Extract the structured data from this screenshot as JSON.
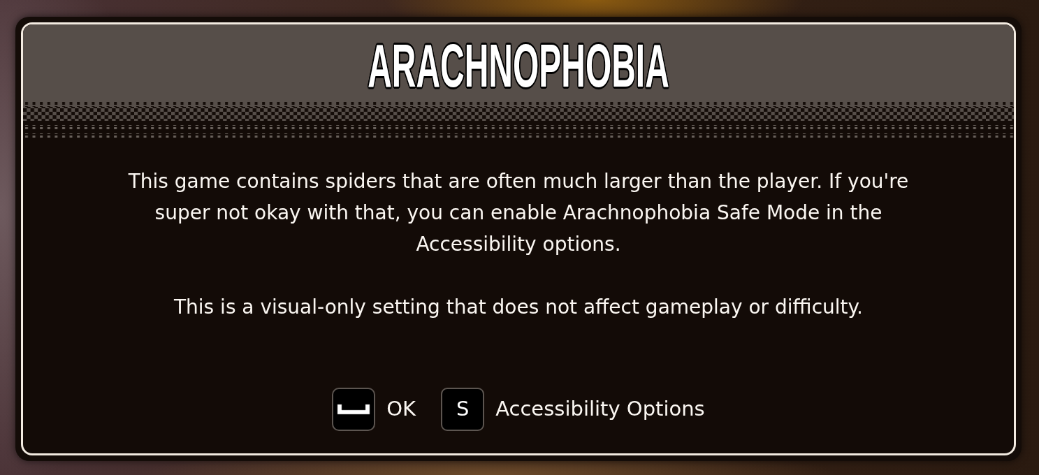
{
  "dialog": {
    "title": "ARACHNOPHOBIA",
    "paragraphs": [
      "This game contains spiders that are often much larger than the player. If you're super not okay with that, you can enable Arachnophobia Safe Mode in the Accessibility options.",
      "This is a visual-only setting that does not affect gameplay or difficulty."
    ]
  },
  "actions": [
    {
      "kind": "space",
      "label": "OK"
    },
    {
      "kind": "key",
      "key": "S",
      "label": "Accessibility Options"
    }
  ]
}
